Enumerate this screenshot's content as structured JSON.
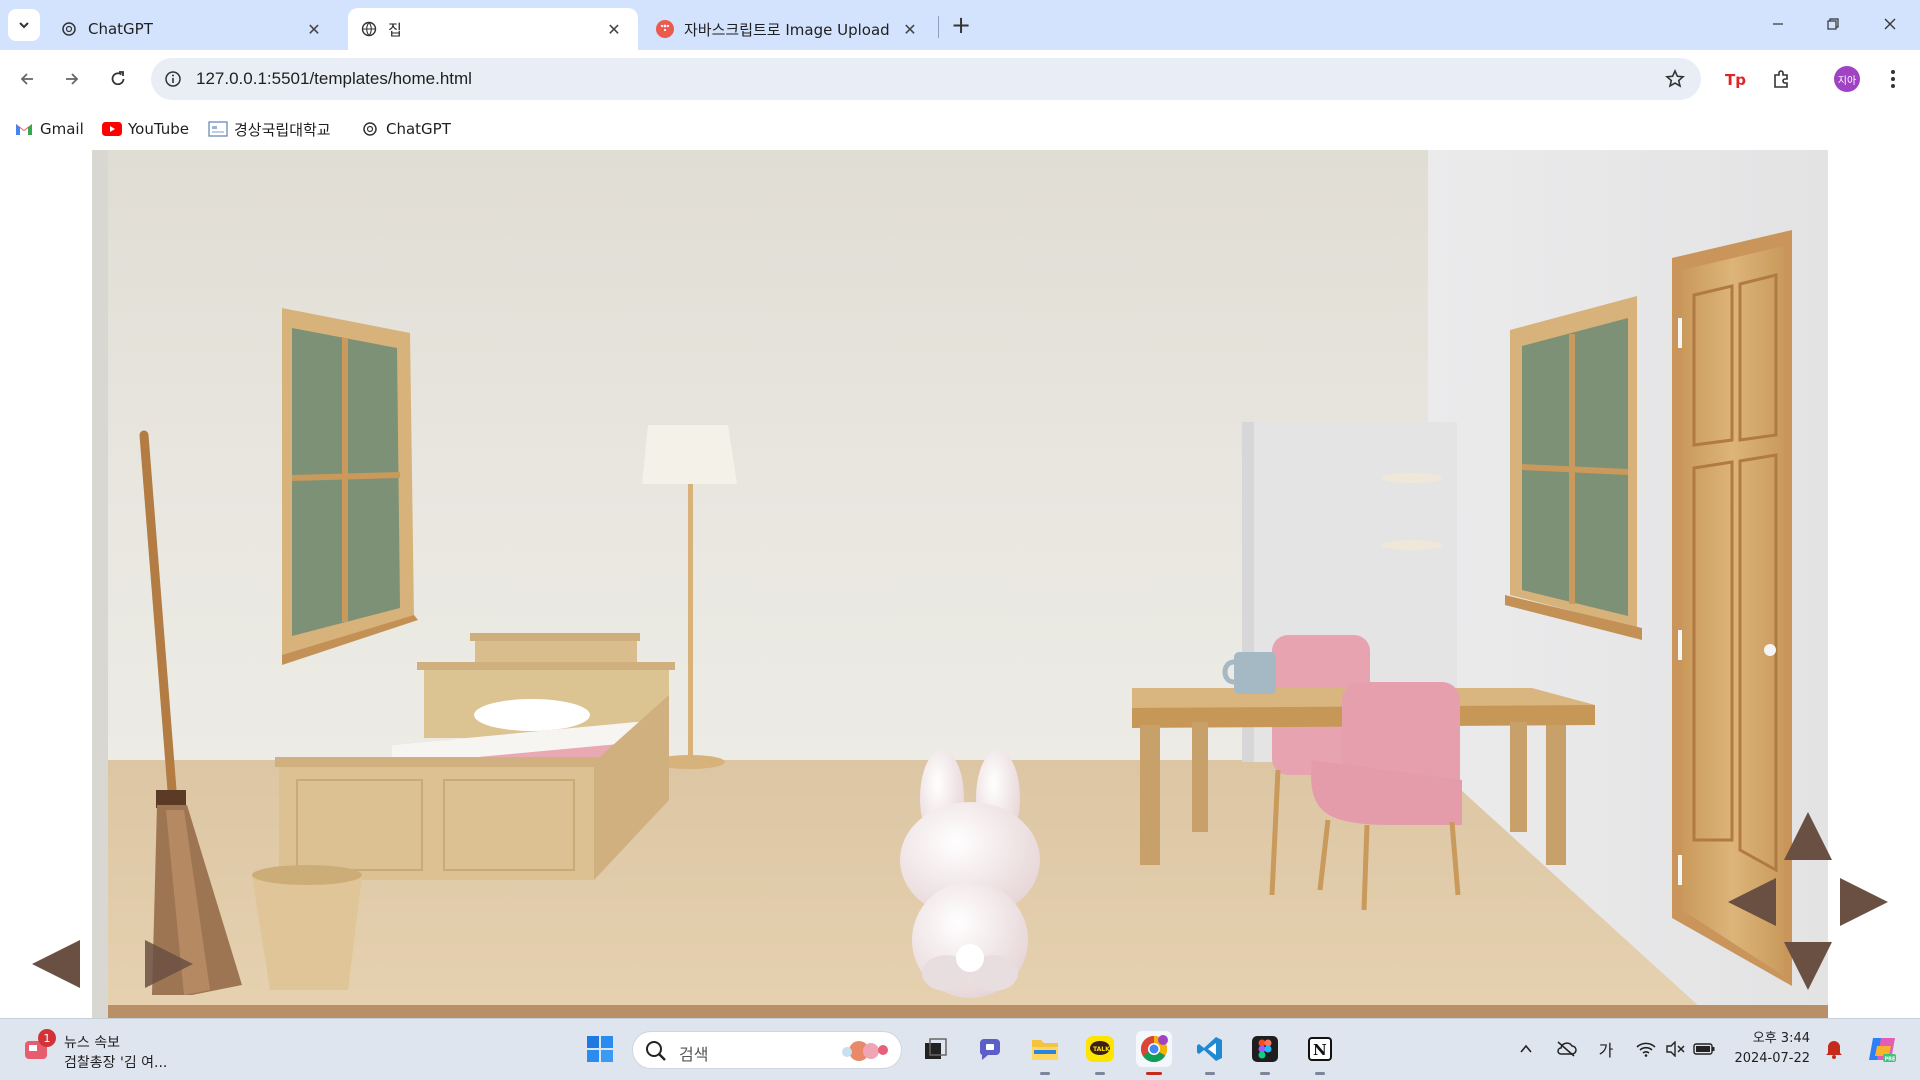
{
  "browser": {
    "tabs": [
      {
        "title": "ChatGPT",
        "active": false,
        "icon": "chatgpt-icon"
      },
      {
        "title": "집",
        "active": true,
        "icon": "globe-icon"
      },
      {
        "title": "자바스크립트로 Image Upload",
        "active": false,
        "icon": "tistory-icon"
      }
    ],
    "url": "127.0.0.1:5501/templates/home.html",
    "profile_initials": "지아",
    "bookmarks": [
      {
        "label": "Gmail",
        "icon": "gmail-icon"
      },
      {
        "label": "YouTube",
        "icon": "youtube-icon"
      },
      {
        "label": "경상국립대학교",
        "icon": "university-icon"
      },
      {
        "label": "ChatGPT",
        "icon": "chatgpt-icon"
      }
    ]
  },
  "scene": {
    "objects": [
      "window-left",
      "broom",
      "bed",
      "floor-lamp",
      "trash-bin",
      "bunny",
      "refrigerator",
      "table",
      "mug",
      "pink-chair-back",
      "pink-chair-front",
      "window-right",
      "door"
    ],
    "controls": [
      "arrow-left-bottom",
      "arrow-right-bottom",
      "arrow-up",
      "arrow-left",
      "arrow-right",
      "arrow-down"
    ]
  },
  "taskbar": {
    "news_badge": "1",
    "news_title": "뉴스 속보",
    "news_sub": "검찰총장 '김 여...",
    "search_placeholder": "검색",
    "apps": [
      "start-icon",
      "task-view-icon",
      "teams-icon",
      "file-explorer-icon",
      "kakaotalk-icon",
      "chrome-icon",
      "vscode-icon",
      "figma-icon",
      "notion-icon"
    ],
    "ime_label": "가",
    "time": "오후 3:44",
    "date": "2024-07-22"
  },
  "colors": {
    "tab_strip": "#d3e3fd",
    "wood": "#d8b47c",
    "pink": "#e8a7b3",
    "arrow": "#6a5042"
  }
}
